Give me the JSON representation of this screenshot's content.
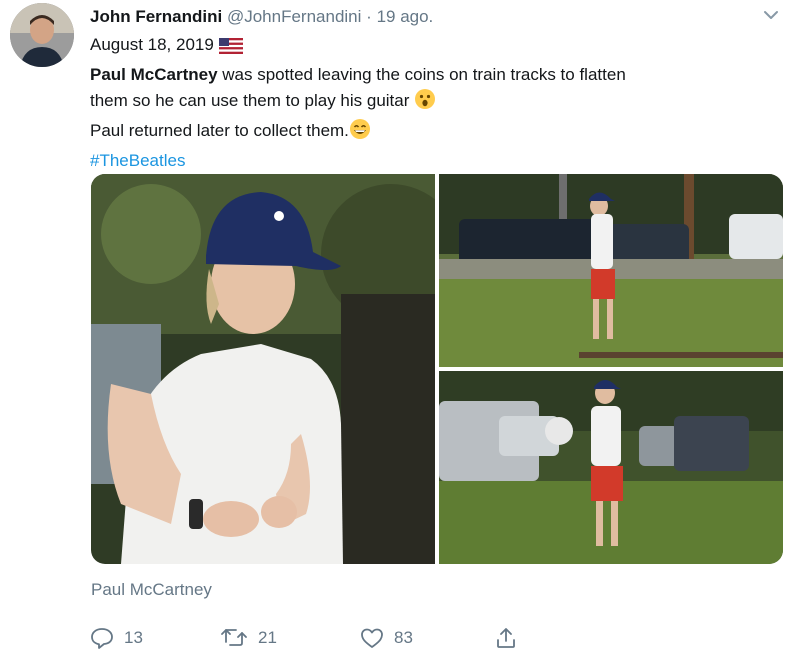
{
  "tweet": {
    "author_name": "John Fernandini",
    "handle": "@JohnFernandini",
    "separator": "·",
    "time": "19 ago.",
    "date_line": "August 18, 2019",
    "date_flag": "us-flag-icon",
    "text_bold": "Paul McCartney",
    "text_line1_rest": " was spotted leaving the coins on train tracks to flatten",
    "text_line2": "them so he can use them to play his guitar ",
    "text_line3": "Paul returned later to collect them.",
    "hashtag": "#TheBeatles"
  },
  "media": {
    "caption": "Paul McCartney"
  },
  "actions": {
    "reply_count": "13",
    "retweet_count": "21",
    "like_count": "83"
  },
  "colors": {
    "link": "#1b95e0",
    "secondary_text": "#657786",
    "name_text": "#14171a"
  }
}
